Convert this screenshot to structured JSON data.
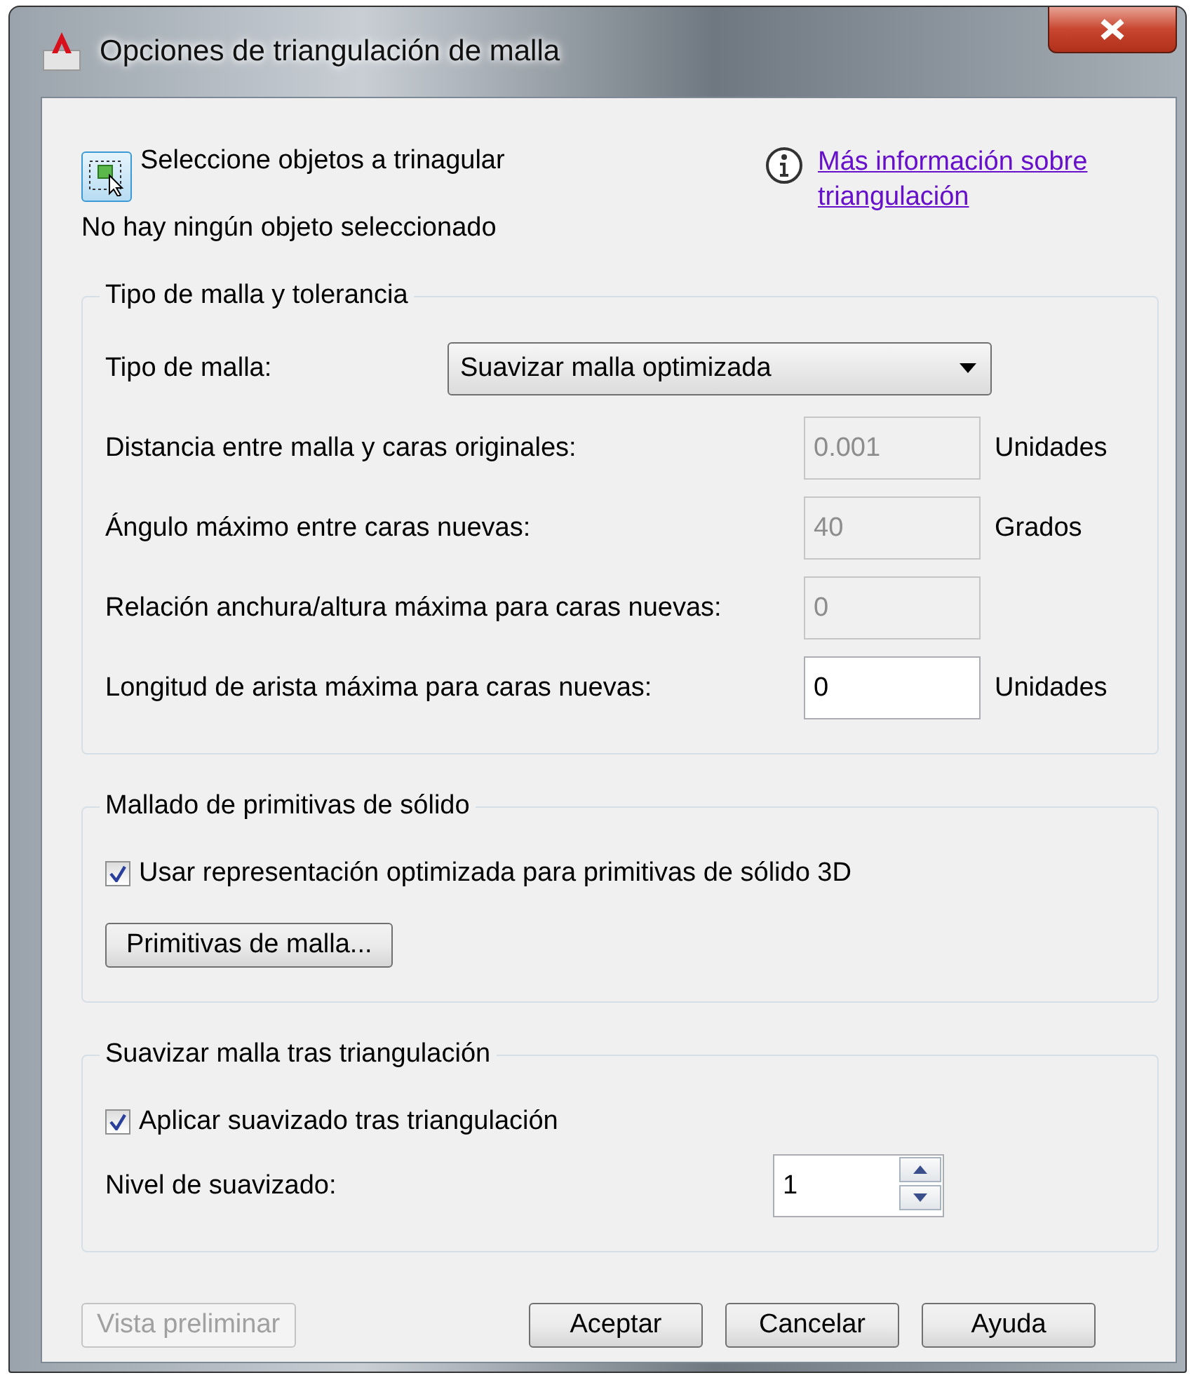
{
  "window": {
    "title": "Opciones de triangulación de malla"
  },
  "selection": {
    "label": "Seleccione objetos a trinagular",
    "status": "No hay ningún objeto seleccionado"
  },
  "help_link": "Más información sobre triangulación",
  "groups": [
    {
      "title": "Tipo de malla y tolerancia",
      "items": [
        {
          "kind": "dropdown",
          "label": "Tipo de malla:",
          "value": "Suavizar malla optimizada"
        },
        {
          "kind": "field",
          "label": "Distancia entre malla y caras originales:",
          "value": "0.001",
          "disabled": true,
          "unit": "Unidades"
        },
        {
          "kind": "field",
          "label": "Ángulo máximo entre caras nuevas:",
          "value": "40",
          "disabled": true,
          "unit": "Grados"
        },
        {
          "kind": "field",
          "label": "Relación anchura/altura máxima para caras nuevas:",
          "value": "0",
          "disabled": true
        },
        {
          "kind": "field",
          "label": "Longitud de arista máxima para caras nuevas:",
          "value": "0",
          "disabled": false,
          "unit": "Unidades"
        }
      ]
    },
    {
      "title": "Mallado de primitivas de sólido",
      "items": [
        {
          "kind": "checkbox",
          "label": "Usar representación optimizada para primitivas de sólido 3D",
          "checked": true
        },
        {
          "kind": "button",
          "label": "Primitivas de malla..."
        }
      ]
    },
    {
      "title": "Suavizar malla tras triangulación",
      "items": [
        {
          "kind": "checkbox",
          "label": "Aplicar suavizado tras triangulación",
          "checked": true
        },
        {
          "kind": "spinner",
          "label": "Nivel de suavizado:",
          "value": "1"
        }
      ]
    }
  ],
  "buttons": [
    {
      "label": "Vista preliminar",
      "disabled": true
    },
    {
      "label": "Aceptar",
      "disabled": false
    },
    {
      "label": "Cancelar",
      "disabled": false
    },
    {
      "label": "Ayuda",
      "disabled": false
    }
  ]
}
